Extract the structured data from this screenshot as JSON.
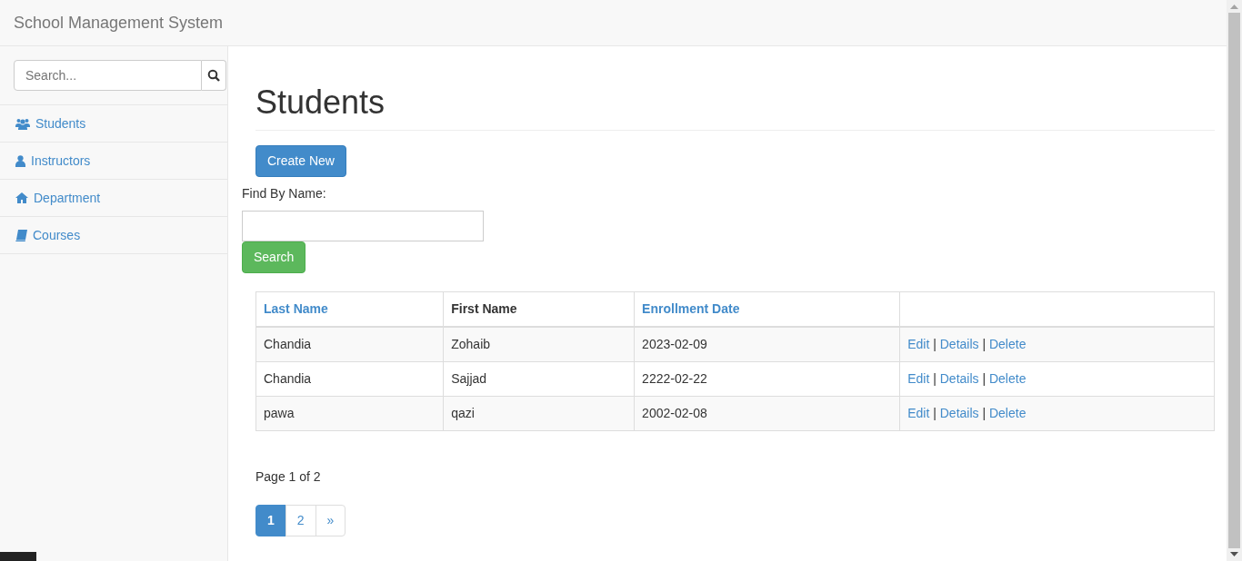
{
  "navbar": {
    "brand": "School Management System"
  },
  "sidebar": {
    "search": {
      "placeholder": "Search..."
    },
    "items": [
      {
        "label": "Students"
      },
      {
        "label": "Instructors"
      },
      {
        "label": "Department"
      },
      {
        "label": "Courses"
      }
    ]
  },
  "main": {
    "title": "Students",
    "create_button": "Create New",
    "find_label": "Find By Name:",
    "search_button": "Search",
    "table": {
      "columns": [
        {
          "label": "Last Name",
          "sortable": true
        },
        {
          "label": "First Name",
          "sortable": false
        },
        {
          "label": "Enrollment Date",
          "sortable": true
        }
      ],
      "rows": [
        {
          "cells": [
            "Chandia",
            "Zohaib",
            "2023-02-09"
          ],
          "actions": [
            {
              "kind": "link",
              "label": "Edit"
            },
            {
              "kind": "text",
              "label": "|"
            },
            {
              "kind": "link",
              "label": "Details"
            },
            {
              "kind": "text",
              "label": "|"
            },
            {
              "kind": "link",
              "label": "Delete"
            }
          ]
        },
        {
          "cells": [
            "Chandia",
            "Sajjad",
            "2222-02-22"
          ],
          "actions": [
            {
              "kind": "link",
              "label": "Edit"
            },
            {
              "kind": "text",
              "label": "|"
            },
            {
              "kind": "link",
              "label": "Details"
            },
            {
              "kind": "text",
              "label": "|"
            },
            {
              "kind": "link",
              "label": "Delete"
            }
          ]
        },
        {
          "cells": [
            "pawa",
            "qazi",
            "2002-02-08"
          ],
          "actions": [
            {
              "kind": "link",
              "label": "Edit"
            },
            {
              "kind": "text",
              "label": "|"
            },
            {
              "kind": "link",
              "label": "Details"
            },
            {
              "kind": "text",
              "label": "|"
            },
            {
              "kind": "link",
              "label": "Delete"
            }
          ]
        }
      ]
    },
    "page_info": "Page 1 of 2",
    "pagination": [
      {
        "label": "1",
        "selected": true
      },
      {
        "label": "2",
        "selected": false
      },
      {
        "label": "»",
        "selected": false
      }
    ]
  }
}
